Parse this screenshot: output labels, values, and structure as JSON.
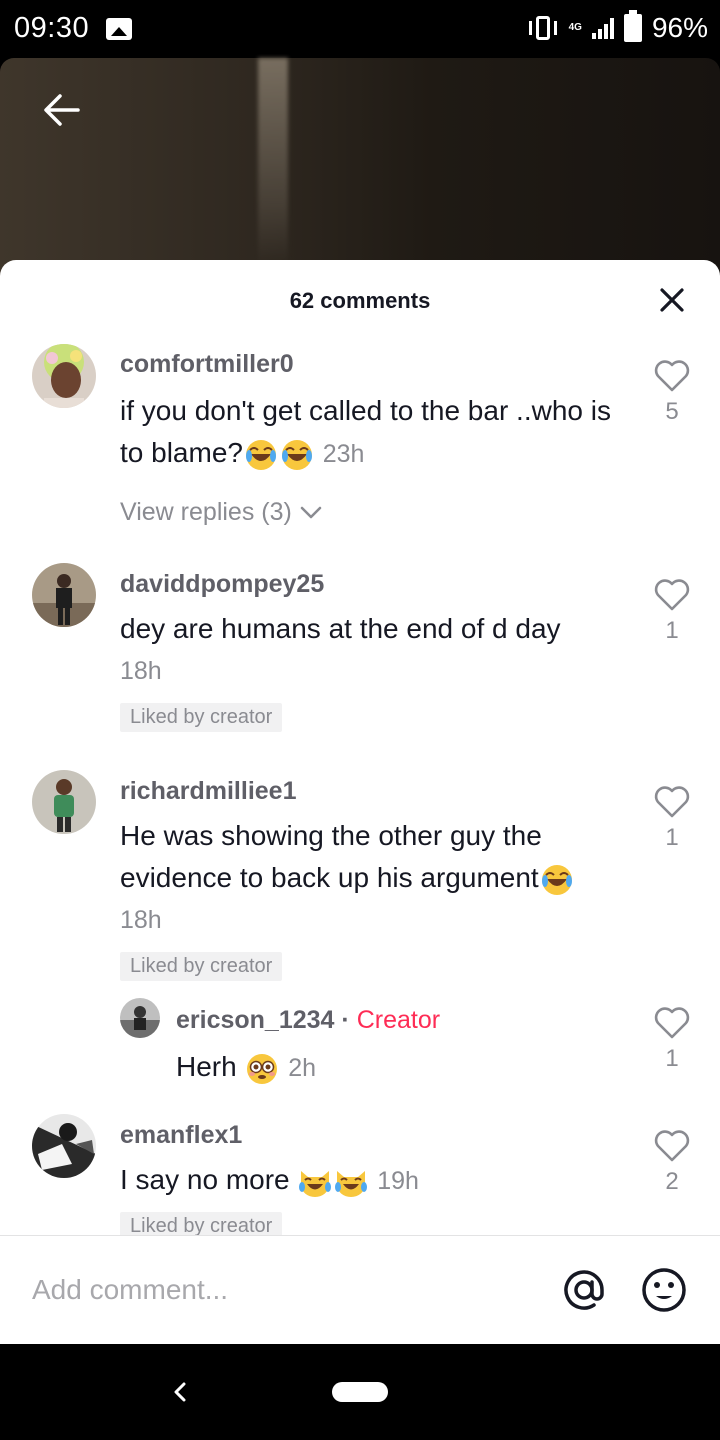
{
  "status_bar": {
    "time": "09:30",
    "network": "4G",
    "battery": "96%"
  },
  "sheet": {
    "title": "62 comments",
    "input_placeholder": "Add comment..."
  },
  "comments": [
    {
      "username": "comfortmiller0",
      "text": "if you don't get called to the bar ..who is to blame?",
      "emoji": [
        "joy",
        "joy"
      ],
      "time": "23h",
      "likes": "5",
      "view_replies": "View replies (3)"
    },
    {
      "username": "daviddpompey25",
      "text": "dey are humans at the end of d day",
      "time": "18h",
      "likes": "1",
      "liked_by_creator": "Liked by creator"
    },
    {
      "username": "richardmilliee1",
      "text": "He was showing the other guy the evidence to back up his argument",
      "emoji": [
        "joy"
      ],
      "time": "18h",
      "likes": "1",
      "liked_by_creator": "Liked by creator",
      "reply": {
        "username": "ericson_1234",
        "separator": "·",
        "badge": "Creator",
        "text": "Herh",
        "emoji": [
          "flushed"
        ],
        "time": "2h",
        "likes": "1"
      }
    },
    {
      "username": "emanflex1",
      "text": "I say no more",
      "emoji": [
        "joy-cat",
        "joy-cat"
      ],
      "time": "19h",
      "likes": "2",
      "liked_by_creator": "Liked by creator"
    }
  ],
  "colors": {
    "accent": "#fe2c55",
    "text_primary": "#161823",
    "text_secondary": "#8a8b91"
  }
}
